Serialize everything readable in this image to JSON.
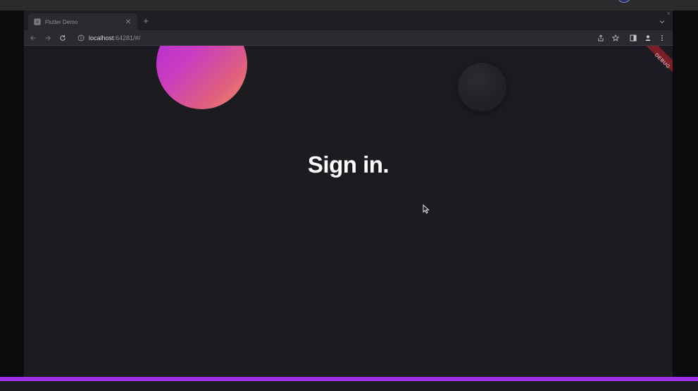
{
  "os": {
    "status_icon": "pie-status-icon"
  },
  "browser": {
    "tab": {
      "title": "Flutter Demo",
      "favicon": "page-favicon-icon",
      "close_icon": "close-icon"
    },
    "new_tab_icon": "plus-icon",
    "tab_search_icon": "chevron-down-icon",
    "window_close_icon": "close-icon",
    "toolbar": {
      "back_icon": "arrow-left-icon",
      "forward_icon": "arrow-right-icon",
      "reload_icon": "reload-icon",
      "site_info_icon": "info-icon",
      "url_host": "localhost",
      "url_rest": ":64281/#/",
      "share_icon": "share-icon",
      "bookmark_icon": "star-icon",
      "side_panel_icon": "side-panel-icon",
      "profile_icon": "profile-icon",
      "menu_icon": "kebab-menu-icon"
    }
  },
  "app": {
    "debug_banner": "DEBUG",
    "heading": "Sign in.",
    "colors": {
      "background": "#1b1b20",
      "orb_gradient_start": "#b42bd8",
      "orb_gradient_end": "#f08a6a",
      "debug_banner": "#7a1f28"
    }
  },
  "progress": {
    "fraction": 1.0,
    "color": "#a030e8"
  }
}
